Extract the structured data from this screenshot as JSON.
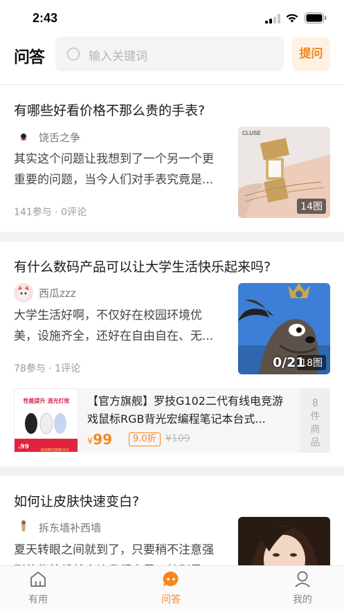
{
  "status_bar": {
    "time": "2:43"
  },
  "header": {
    "logo": "问答",
    "search_placeholder": "输入关键词",
    "ask_label": "提问"
  },
  "questions": [
    {
      "title": "有哪些好看价格不那么贵的手表?",
      "author": "饶舌之争",
      "excerpt": "其实这个问题让我想到了一个另一个更重要的问题，当今人们对手表究竟是...",
      "stats": "141参与 · 0评论",
      "image_badge": "14图",
      "image_brand": "CLUSE"
    },
    {
      "title": "有什么数码产品可以让大学生活快乐起来吗?",
      "author": "西瓜zzz",
      "excerpt": "大学生活好啊，不仅好在校园环境优美，设施齐全，还好在自由自在、无...",
      "stats": "78参与 · 1评论",
      "image_badge": "18图",
      "image_overlay": "0/21"
    },
    {
      "title": "如何让皮肤快速变白?",
      "author": "拆东墙补西墙",
      "excerpt": "夏天转眼之间就到了，只要稍不注意强烈的紫外线就会让我们变黑，特别是..."
    }
  ],
  "product": {
    "title": "【官方旗舰】罗技G102二代有线电竞游戏鼠标RGB背光宏编程笔记本台式...",
    "price_symbol": "¥",
    "price": "99",
    "discount": "9.0折",
    "original_price": "¥109",
    "more_label": "8件商品",
    "more_lines": [
      "8",
      "件",
      "商",
      "品"
    ],
    "ad_headline": "性能提升 流光灯效",
    "ad_subline": "G102二代有线电竞鼠标",
    "ad_price": ".99",
    "ad_footer": "活动限时直降20元"
  },
  "tabbar": {
    "tabs": [
      {
        "label": "有用",
        "active": false
      },
      {
        "label": "问答",
        "active": true
      },
      {
        "label": "我的",
        "active": false
      }
    ]
  },
  "colors": {
    "accent": "#f7851e",
    "ask_bg": "#fff2e4",
    "divider": "#f2f2f2"
  }
}
